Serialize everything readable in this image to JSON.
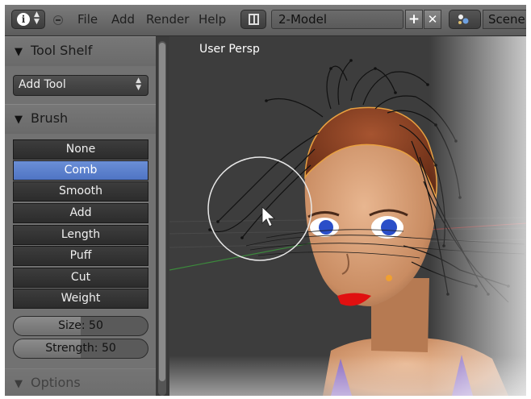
{
  "header": {
    "menus": [
      "File",
      "Add",
      "Render",
      "Help"
    ],
    "screen_layout": "2-Model",
    "add_symbol": "+",
    "remove_symbol": "✕",
    "scene_name": "Scene"
  },
  "toolshelf": {
    "title": "Tool Shelf",
    "add_tool_label": "Add Tool",
    "brush_panel_title": "Brush",
    "brushes": [
      "None",
      "Comb",
      "Smooth",
      "Add",
      "Length",
      "Puff",
      "Cut",
      "Weight"
    ],
    "active_brush": "Comb",
    "size_label": "Size: 50",
    "strength_label": "Strength: 50",
    "size_fill_fraction": 0.5,
    "strength_fill_fraction": 0.5,
    "options_panel_title": "Options"
  },
  "viewport": {
    "label": "User Persp"
  },
  "colors": {
    "active_brush": "#5a7fd0",
    "header": "#6e6e6e",
    "panel": "#727272"
  },
  "icons": [
    "info-icon",
    "minimize-icon",
    "screen-layout-icon",
    "add-icon",
    "close-icon",
    "scene-icon",
    "expand-triangle-icon",
    "mouse-cursor-icon"
  ]
}
